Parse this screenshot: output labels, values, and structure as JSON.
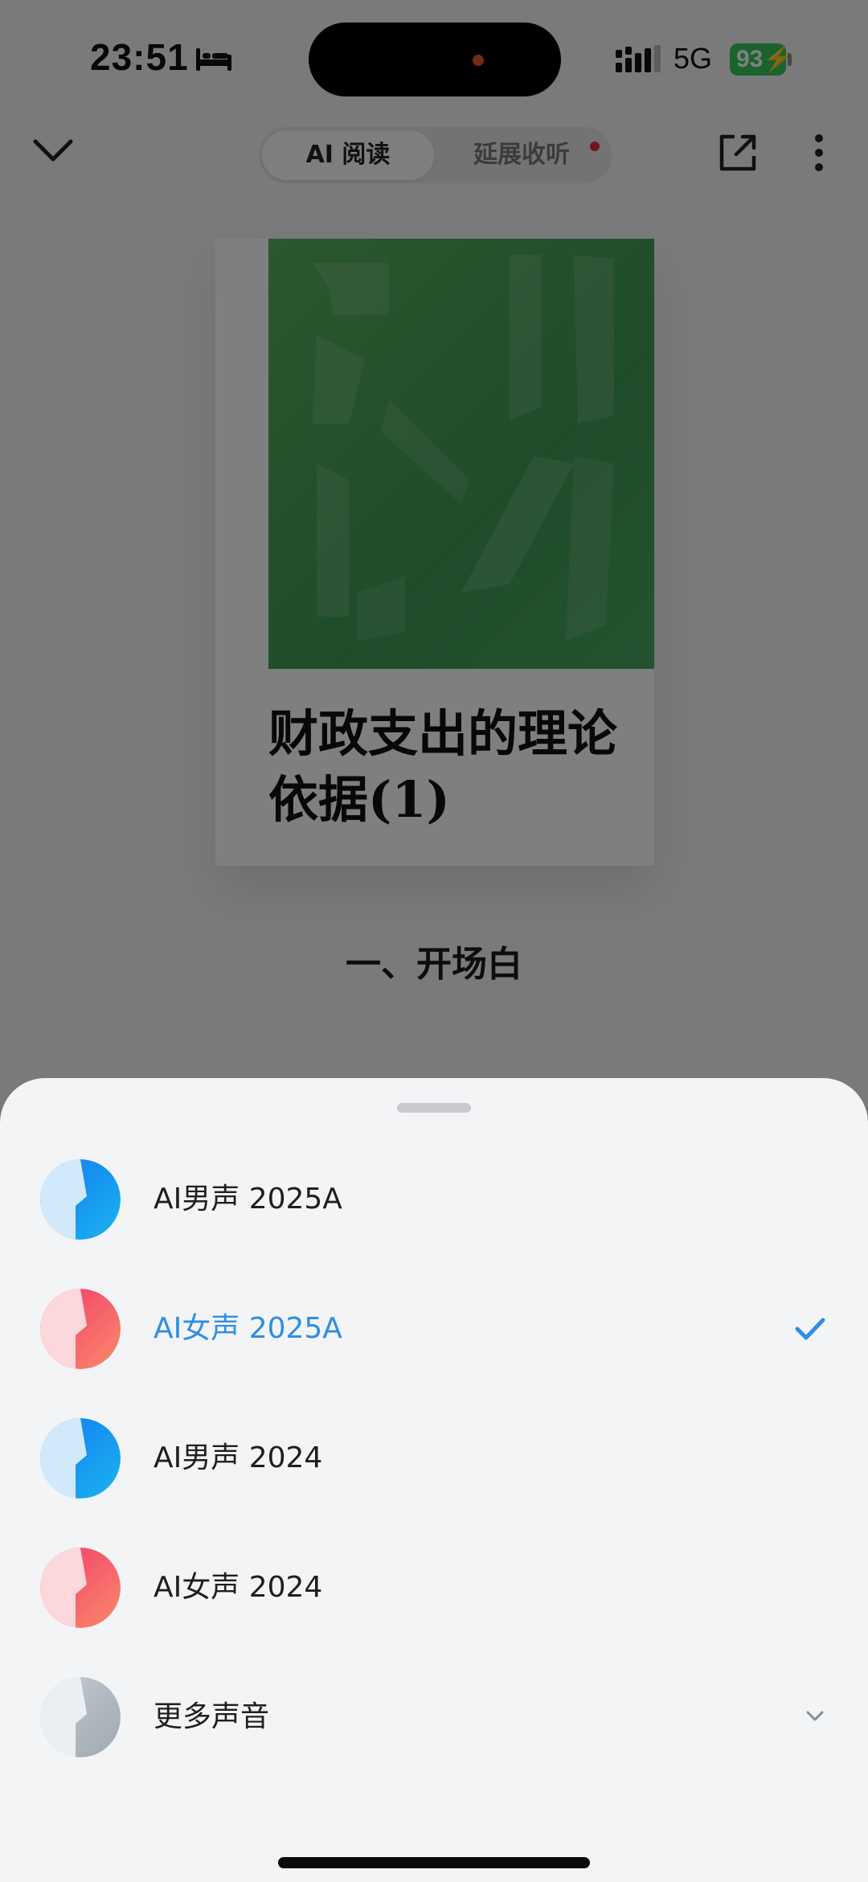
{
  "status_bar": {
    "time": "23:51",
    "network": "5G",
    "battery": "93"
  },
  "nav": {
    "tabs": [
      {
        "label": "AI 阅读",
        "active": true
      },
      {
        "label": "延展收听",
        "active": false,
        "has_dot": true
      }
    ],
    "icons": [
      "chevron-down-icon",
      "share-icon",
      "more-vertical-icon"
    ]
  },
  "book": {
    "cover_title": "财政支出的理论依据(1)",
    "cover_color": "#4aa75a"
  },
  "content": {
    "chapter_title": "一、开场白"
  },
  "voice_sheet": {
    "voices": [
      {
        "label": "AI男声 2025A",
        "gender": "male",
        "selected": false
      },
      {
        "label": "AI女声 2025A",
        "gender": "female",
        "selected": true
      },
      {
        "label": "AI男声 2024",
        "gender": "male",
        "selected": false
      },
      {
        "label": "AI女声 2024",
        "gender": "female",
        "selected": false
      },
      {
        "label": "更多声音",
        "gender": "neutral",
        "selected": false,
        "expandable": true
      }
    ],
    "accent_color": "#2f8de4"
  }
}
